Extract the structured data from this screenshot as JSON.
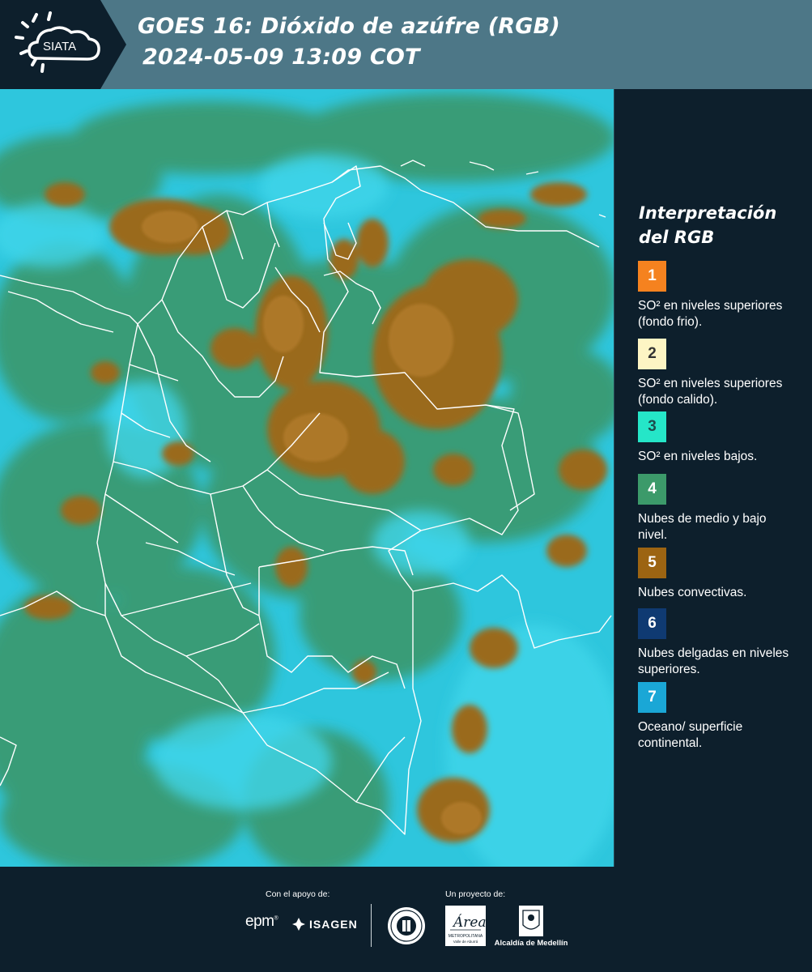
{
  "header": {
    "logo_text": "SIATA",
    "title_line1": "GOES 16: Dióxido de azúfre (RGB)",
    "title_line2": "2024-05-09 13:09 COT"
  },
  "legend": {
    "title": "Interpretación del RGB",
    "items": [
      {
        "num": "1",
        "color": "#f5821f",
        "num_color": "#ffffff",
        "desc": "SO² en niveles superiores (fondo frio)."
      },
      {
        "num": "2",
        "color": "#fdf5c4",
        "num_color": "#333333",
        "desc": "SO² en niveles superiores (fondo calido)."
      },
      {
        "num": "3",
        "color": "#25e6c8",
        "num_color": "#1d4d4d",
        "desc": "SO² en niveles bajos."
      },
      {
        "num": "4",
        "color": "#3c9a6a",
        "num_color": "#ffffff",
        "desc": "Nubes de medio y bajo nivel."
      },
      {
        "num": "5",
        "color": "#9c6412",
        "num_color": "#ffffff",
        "desc": "Nubes convectivas."
      },
      {
        "num": "6",
        "color": "#0f3a72",
        "num_color": "#ffffff",
        "desc": "Nubes delgadas en niveles superiores."
      },
      {
        "num": "7",
        "color": "#1aa7d6",
        "num_color": "#ffffff",
        "desc": "Oceano/ superficie continental."
      }
    ]
  },
  "footer": {
    "support_label": "Con el apoyo de:",
    "project_label": "Un proyecto de:",
    "sponsor_epm": "epm",
    "sponsor_isagen": "ISAGEN",
    "amva_text": "Área",
    "amva_sub": "METROPOLITANA",
    "amva_sub2": "Valle de Aburrá",
    "alcaldia": "Alcaldía de Medellín"
  },
  "colors": {
    "header_bg": "#4d7787",
    "logo_bg": "#0d1f2c",
    "panel_bg": "#0d1f2c",
    "ocean": "#2bc4dc",
    "low_cloud": "#3c9a6a",
    "convective": "#9c6412"
  }
}
